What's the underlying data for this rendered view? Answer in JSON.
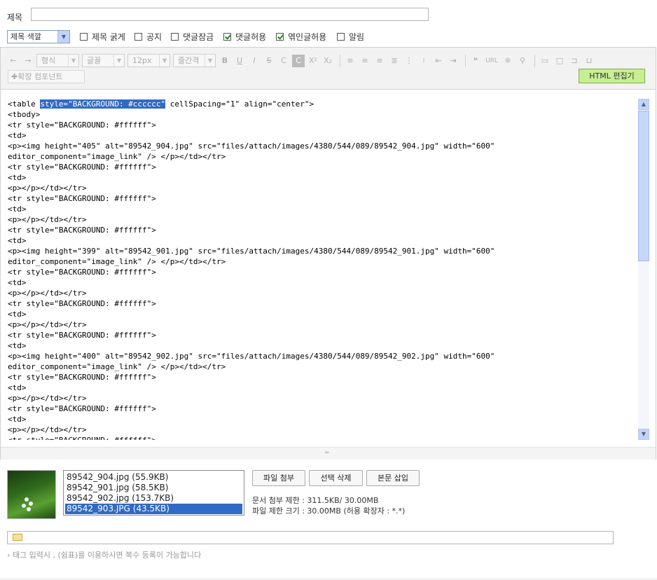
{
  "title_row": {
    "label": "제목",
    "value": ""
  },
  "options": {
    "color_select": "제목 색깔",
    "checkboxes": [
      {
        "label": "제목 굵게",
        "checked": false
      },
      {
        "label": "공지",
        "checked": false
      },
      {
        "label": "댓글잠금",
        "checked": false
      },
      {
        "label": "댓글허용",
        "checked": true
      },
      {
        "label": "엮인글허용",
        "checked": true
      },
      {
        "label": "알림",
        "checked": false
      }
    ]
  },
  "toolbar": {
    "format_select": "형식",
    "font_select": "글꼴",
    "size_select": "12px",
    "lineheight_select": "줄간격",
    "url_label": "URL",
    "ext_component": "확장 컴포넌트",
    "html_editor_button": "HTML 편집기"
  },
  "code": {
    "first_before": "<table ",
    "first_highlight": "style=\"BACKGROUND: #cccccc\"",
    "first_after": " cellSpacing=\"1\" align=\"center\">",
    "rest": "<tbody>\n<tr style=\"BACKGROUND: #ffffff\">\n<td>\n<p><img height=\"405\" alt=\"89542_904.jpg\" src=\"files/attach/images/4380/544/089/89542_904.jpg\" width=\"600\"\neditor_component=\"image_link\" /> </p></td></tr>\n<tr style=\"BACKGROUND: #ffffff\">\n<td>\n<p></p></td></tr>\n<tr style=\"BACKGROUND: #ffffff\">\n<td>\n<p></p></td></tr>\n<tr style=\"BACKGROUND: #ffffff\">\n<td>\n<p><img height=\"399\" alt=\"89542_901.jpg\" src=\"files/attach/images/4380/544/089/89542_901.jpg\" width=\"600\"\neditor_component=\"image_link\" /> </p></td></tr>\n<tr style=\"BACKGROUND: #ffffff\">\n<td>\n<p></p></td></tr>\n<tr style=\"BACKGROUND: #ffffff\">\n<td>\n<p></p></td></tr>\n<tr style=\"BACKGROUND: #ffffff\">\n<td>\n<p><img height=\"400\" alt=\"89542_902.jpg\" src=\"files/attach/images/4380/544/089/89542_902.jpg\" width=\"600\"\neditor_component=\"image_link\" /> </p></td></tr>\n<tr style=\"BACKGROUND: #ffffff\">\n<td>\n<p></p></td></tr>\n<tr style=\"BACKGROUND: #ffffff\">\n<td>\n<p></p></td></tr>\n<tr style=\"BACKGROUND: #ffffff\">"
  },
  "attachments": {
    "files": [
      {
        "name": "89542_904.jpg (55.9KB)",
        "selected": false
      },
      {
        "name": "89542_901.jpg (58.5KB)",
        "selected": false
      },
      {
        "name": "89542_902.jpg (153.7KB)",
        "selected": false
      },
      {
        "name": "89542_903.JPG (43.5KB)",
        "selected": true
      }
    ],
    "attach_button": "파일 첨부",
    "delete_button": "선택 삭제",
    "insert_button": "본문 삽입",
    "doc_limit": "문서 첨부 제한 : 311.5KB/ 30.00MB",
    "file_limit": "파일 제한 크기 : 30.00MB (허용 확장자 : *.*)"
  },
  "tags": {
    "value": "",
    "help": "태그 입력시 , (쉼표)를 이용하시면 복수 등록이 가능합니다"
  },
  "colors": {
    "accent": "#316ac5",
    "html_button": "#c7ee92",
    "check": "#1f8a1f"
  }
}
